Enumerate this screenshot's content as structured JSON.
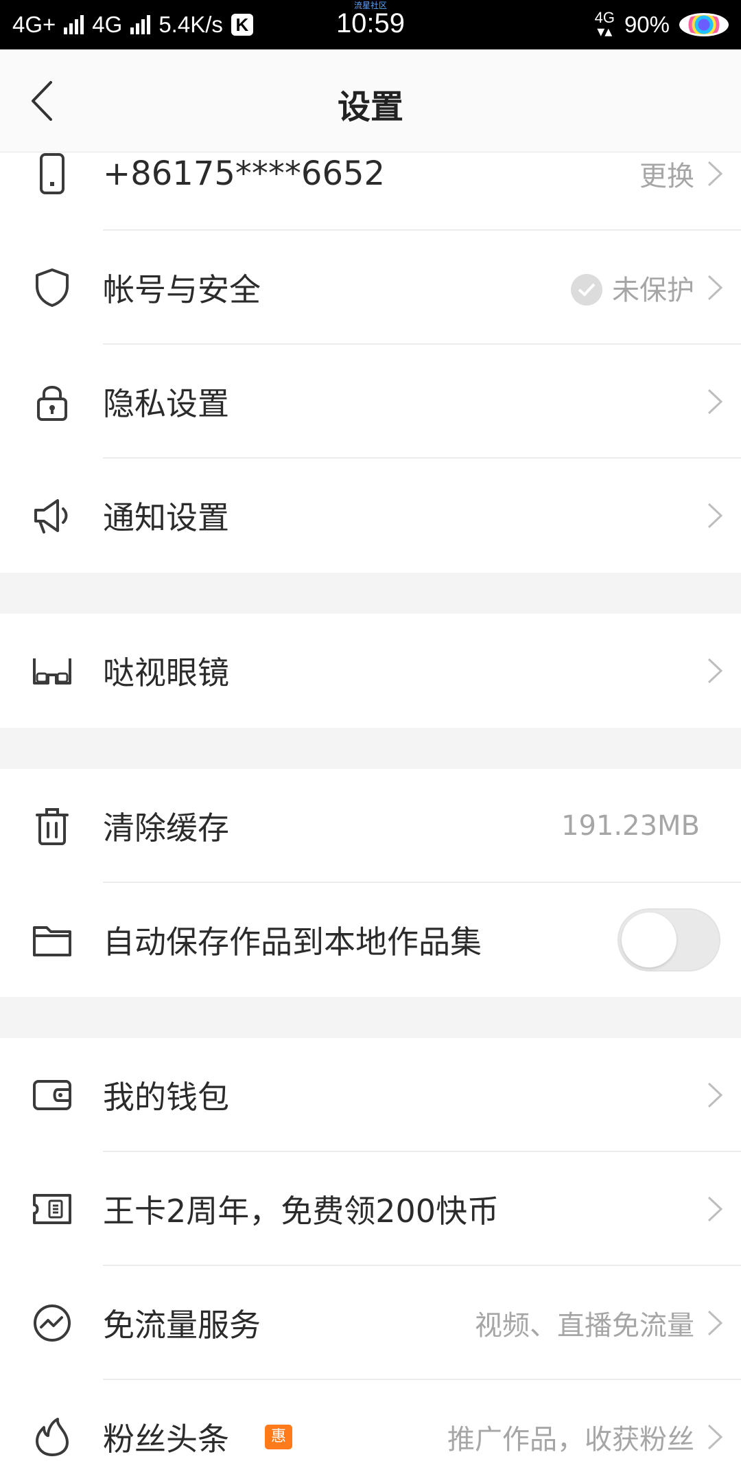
{
  "status_bar": {
    "network_left": "4G+",
    "network_mid": "4G",
    "speed": "5.4K/s",
    "k_badge": "K",
    "carrier_note": "流星社区",
    "time": "10:59",
    "network_right": "4G",
    "battery": "90%"
  },
  "header": {
    "title": "设置"
  },
  "rows": {
    "phone": {
      "label": "+86175****6652",
      "value": "更换",
      "icon": "phone-icon"
    },
    "account": {
      "label": "帐号与安全",
      "value": "未保护",
      "icon": "shield-icon"
    },
    "privacy": {
      "label": "隐私设置",
      "icon": "lock-icon"
    },
    "notify": {
      "label": "通知设置",
      "icon": "megaphone-icon"
    },
    "glasses": {
      "label": "哒视眼镜",
      "icon": "glasses-icon"
    },
    "cache": {
      "label": "清除缓存",
      "value": "191.23MB",
      "icon": "trash-icon"
    },
    "autosave": {
      "label": "自动保存作品到本地作品集",
      "toggle_on": false,
      "icon": "folder-icon"
    },
    "wallet": {
      "label": "我的钱包",
      "icon": "wallet-icon"
    },
    "wangka": {
      "label": "王卡2周年，免费领200快币",
      "icon": "coupon-icon"
    },
    "freeflow": {
      "label": "免流量服务",
      "value": "视频、直播免流量",
      "icon": "trend-icon"
    },
    "fans": {
      "label": "粉丝头条",
      "badge": "惠",
      "value": "推广作品，收获粉丝",
      "icon": "flame-icon"
    }
  },
  "colors": {
    "text": "#2b2b2b",
    "secondary": "#a6a6a6",
    "separator_band": "#f4f4f4",
    "badge": "#ff7a1a"
  }
}
